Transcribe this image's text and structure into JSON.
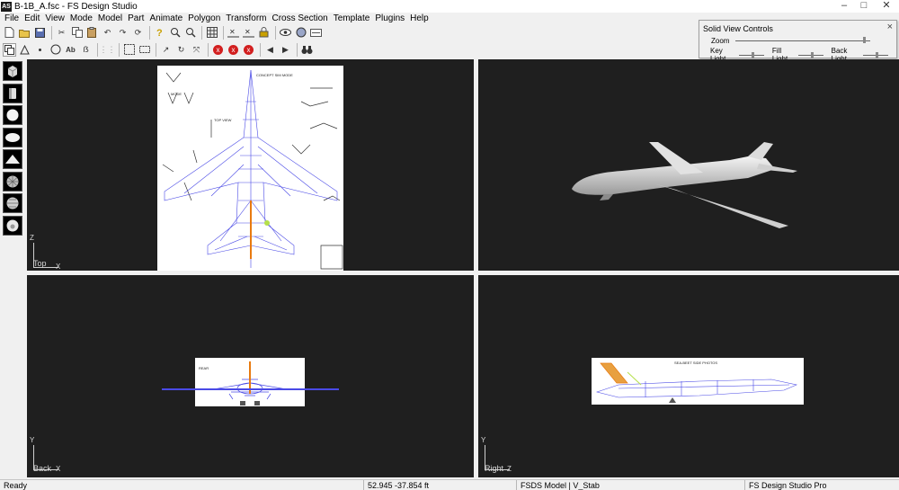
{
  "window": {
    "title": "B-1B_A.fsc - FS Design Studio",
    "icon_text": "AS"
  },
  "menu": [
    "File",
    "Edit",
    "View",
    "Mode",
    "Model",
    "Part",
    "Animate",
    "Polygon",
    "Transform",
    "Cross Section",
    "Template",
    "Plugins",
    "Help"
  ],
  "toolbar": {
    "ab_label": "Ab",
    "x_label": "x",
    "copy_label": "x"
  },
  "solid_view_controls": {
    "title": "Solid View Controls",
    "zoom_label": "Zoom",
    "key_light_label": "Key Light",
    "fill_light_label": "Fill Light",
    "back_light_label": "Back Light",
    "close_glyph": "×"
  },
  "viewports": {
    "top": {
      "label": "Top",
      "axis_v": "Z",
      "axis_h": "X"
    },
    "back": {
      "label": "Back",
      "axis_v": "Y",
      "axis_h": "X"
    },
    "right": {
      "label": "Right",
      "axis_v": "Y",
      "axis_h": "Z"
    }
  },
  "status": {
    "ready": "Ready",
    "coords": "52.945  -37.854 ft",
    "model": "FSDS Model | V_Stab",
    "edition": "FS Design Studio Pro"
  },
  "colors": {
    "viewport_bg": "#1f1f1f",
    "wireframe": "#4a4ae6",
    "selection": "#e87a10"
  }
}
